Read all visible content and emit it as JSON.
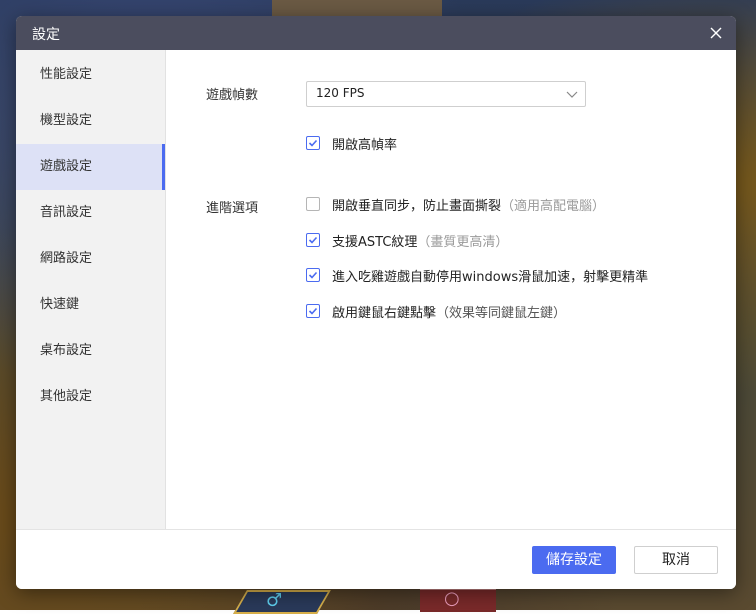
{
  "dialog": {
    "title": "設定",
    "close_icon": "close-icon"
  },
  "sidebar": {
    "items": [
      {
        "label": "性能設定",
        "active": false
      },
      {
        "label": "機型設定",
        "active": false
      },
      {
        "label": "遊戲設定",
        "active": true
      },
      {
        "label": "音訊設定",
        "active": false
      },
      {
        "label": "網路設定",
        "active": false
      },
      {
        "label": "快速鍵",
        "active": false
      },
      {
        "label": "桌布設定",
        "active": false
      },
      {
        "label": "其他設定",
        "active": false
      }
    ]
  },
  "main": {
    "framerate": {
      "label": "遊戲幀數",
      "selected": "120 FPS",
      "high_fps": {
        "label": "開啟高幀率",
        "checked": true
      }
    },
    "advanced": {
      "label": "進階選項",
      "options": [
        {
          "label": "開啟垂直同步，防止畫面撕裂",
          "hint": "（適用高配電腦）",
          "checked": false
        },
        {
          "label": "支援ASTC紋理",
          "hint": "（畫質更高清）",
          "checked": true
        },
        {
          "label": "進入吃雞遊戲自動停用windows滑鼠加速，射擊更精準",
          "hint": "",
          "checked": true
        },
        {
          "label": "啟用鍵鼠右鍵點擊",
          "hint": "（效果等同鍵鼠左鍵）",
          "checked": true
        }
      ]
    }
  },
  "footer": {
    "save_label": "儲存設定",
    "cancel_label": "取消"
  },
  "colors": {
    "accent": "#4b6bf0",
    "titlebar": "#4b4d5e",
    "active_item_bg": "#dde1f6"
  }
}
